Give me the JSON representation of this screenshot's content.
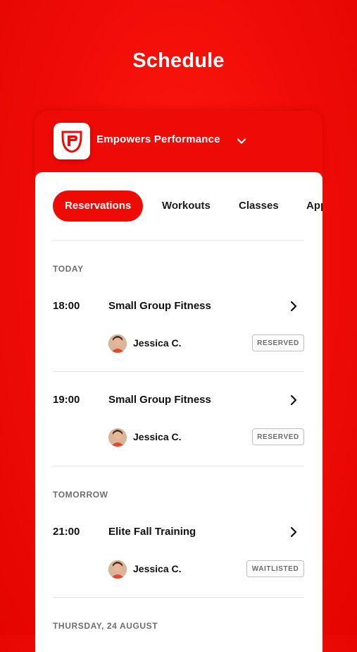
{
  "page": {
    "title": "Schedule"
  },
  "organization": {
    "name": "Empowers Performance",
    "logo_icon": "empowers-performance-logo",
    "dropdown_icon": "chevron-down-icon",
    "brand_color": "#ee0b05"
  },
  "tabs": [
    {
      "label": "Reservations",
      "active": true
    },
    {
      "label": "Workouts",
      "active": false
    },
    {
      "label": "Classes",
      "active": false
    },
    {
      "label": "App",
      "active": false
    }
  ],
  "sections": [
    {
      "label": "TODAY",
      "items": [
        {
          "time": "18:00",
          "title": "Small Group Fitness",
          "coach": "Jessica C.",
          "status": "RESERVED"
        },
        {
          "time": "19:00",
          "title": "Small Group Fitness",
          "coach": "Jessica C.",
          "status": "RESERVED"
        }
      ]
    },
    {
      "label": "TOMORROW",
      "items": [
        {
          "time": "21:00",
          "title": "Elite Fall Training",
          "coach": "Jessica C.",
          "status": "WAITLISTED"
        }
      ]
    },
    {
      "label": "THURSDAY, 24 AUGUST",
      "items": []
    }
  ]
}
